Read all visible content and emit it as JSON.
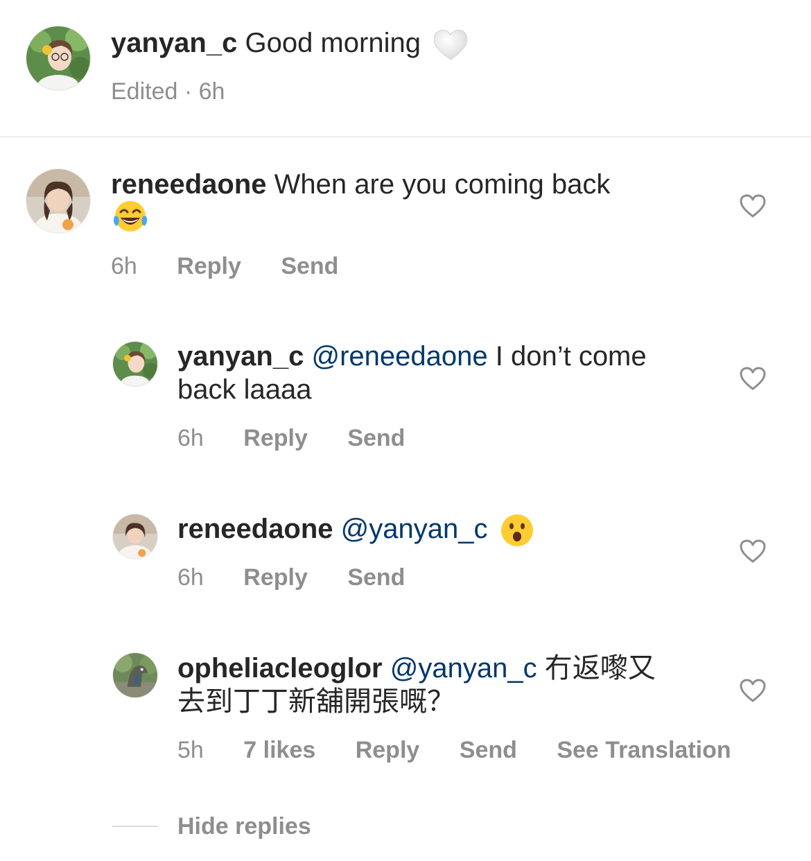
{
  "caption": {
    "username": "yanyan_c",
    "text": "Good morning",
    "emoji": "white-heart-emoji",
    "meta": "Edited · 6h"
  },
  "comments": [
    {
      "username": "reneedaone",
      "text_line1": "When are you coming back",
      "emoji": "tears-of-joy-emoji",
      "time": "6h",
      "reply": "Reply",
      "send": "Send"
    },
    {
      "username": "yanyan_c",
      "mention": "@reneedaone",
      "text_line1": "I don’t come",
      "text_line2": "back laaaa",
      "time": "6h",
      "reply": "Reply",
      "send": "Send"
    },
    {
      "username": "reneedaone",
      "mention": "@yanyan_c",
      "emoji": "hushed-face-emoji",
      "time": "6h",
      "reply": "Reply",
      "send": "Send"
    },
    {
      "username": "opheliacleoglor",
      "mention": "@yanyan_c",
      "text_line1": "冇返嚟又",
      "text_line2": "去到丁丁新舖開張嘅？",
      "time": "5h",
      "likes": "7 likes",
      "reply": "Reply",
      "send": "Send",
      "translate": "See Translation"
    }
  ],
  "hide_replies": "Hide replies",
  "colors": {
    "text": "#262626",
    "muted": "#8e8e8e",
    "mention": "#00376b",
    "divider": "#dbdbdb"
  }
}
